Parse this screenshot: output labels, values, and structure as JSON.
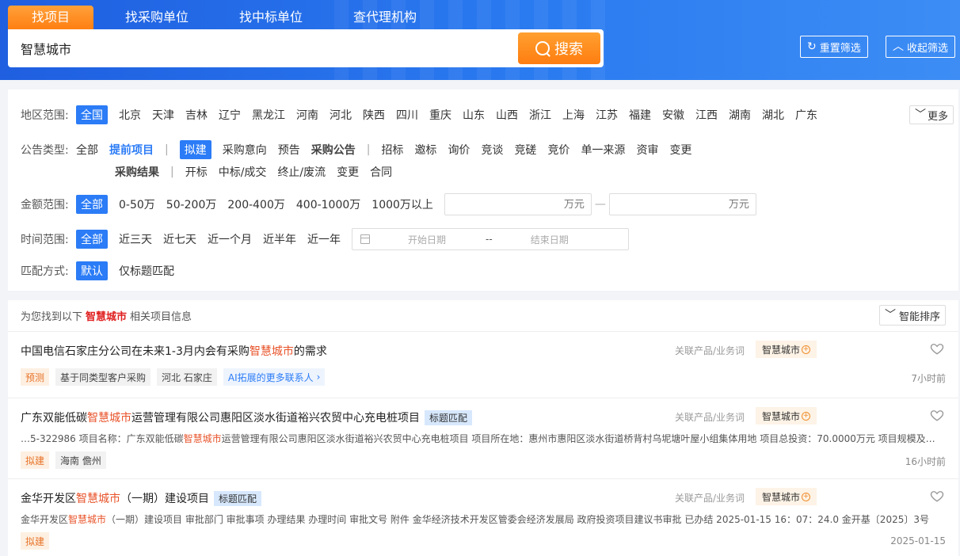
{
  "tabs": [
    "找项目",
    "找采购单位",
    "找中标单位",
    "查代理机构"
  ],
  "search": {
    "value": "智慧城市",
    "button": "搜索"
  },
  "header_buttons": {
    "reset": "重置筛选",
    "collapse": "收起筛选"
  },
  "filters": {
    "region": {
      "label": "地区范围:",
      "options": [
        "全国",
        "北京",
        "天津",
        "吉林",
        "辽宁",
        "黑龙江",
        "河南",
        "河北",
        "陕西",
        "四川",
        "重庆",
        "山东",
        "山西",
        "浙江",
        "上海",
        "江苏",
        "福建",
        "安徽",
        "江西",
        "湖南",
        "湖北",
        "广东"
      ],
      "more": "更多"
    },
    "type": {
      "label": "公告类型:",
      "row1": [
        "全部",
        "提前项目",
        "拟建",
        "采购意向",
        "预告",
        "采购公告",
        "招标",
        "邀标",
        "询价",
        "竞谈",
        "竞磋",
        "竞价",
        "单一来源",
        "资审",
        "变更"
      ],
      "row2": [
        "采购结果",
        "开标",
        "中标/成交",
        "终止/废流",
        "变更",
        "合同"
      ]
    },
    "amount": {
      "label": "金额范围:",
      "options": [
        "全部",
        "0-50万",
        "50-200万",
        "200-400万",
        "400-1000万",
        "1000万以上"
      ],
      "unit_placeholder": "万元",
      "sep": "—"
    },
    "time": {
      "label": "时间范围:",
      "options": [
        "全部",
        "近三天",
        "近七天",
        "近一个月",
        "近半年",
        "近一年"
      ],
      "start_placeholder": "开始日期",
      "end_placeholder": "结束日期",
      "sep": "--"
    },
    "match": {
      "label": "匹配方式:",
      "options": [
        "默认",
        "仅标题匹配"
      ]
    }
  },
  "results": {
    "header_prefix": "为您找到以下",
    "keyword": "智慧城市",
    "header_suffix": "相关项目信息",
    "sort": "智能排序",
    "rel_label": "关联产品/业务词",
    "rel_tag": "智慧城市",
    "items": [
      {
        "title_pre": "中国电信石家庄分公司在未来1-3月内会有采购",
        "title_hl": "智慧城市",
        "title_post": "的需求",
        "match": "",
        "desc_pre": "",
        "desc_hl": "",
        "desc_post": "",
        "badges": [
          "预测",
          "基于同类型客户采购",
          "河北 石家庄",
          "AI拓展的更多联系人"
        ],
        "time": "7小时前"
      },
      {
        "title_pre": "广东双能低碳",
        "title_hl": "智慧城市",
        "title_post": "运营管理有限公司惠阳区淡水街道裕兴农贸中心充电桩项目",
        "match": "标题匹配",
        "desc_pre": "…5-322986 项目名称：广东双能低碳",
        "desc_hl": "智慧城市",
        "desc_post": "运营管理有限公司惠阳区淡水街道裕兴农贸中心充电桩项目 项目所在地：惠州市惠阳区淡水街道桥背村乌坭塘叶屋小组集体用地 项目总投资：70.0000万元 项目规模及…",
        "badges": [
          "拟建",
          "海南 儋州"
        ],
        "time": "16小时前"
      },
      {
        "title_pre": "金华开发区",
        "title_hl": "智慧城市",
        "title_post": "（一期）建设项目",
        "match": "标题匹配",
        "desc_pre": "金华开发区",
        "desc_hl": "智慧城市",
        "desc_post": "（一期）建设项目 审批部门 审批事项 办理结果 办理时间 审批文号 附件 金华经济技术开发区管委会经济发展局 政府投资项目建议书审批 已办结 2025-01-15 16：07：24.0 金开基〔2025〕3号",
        "badges": [
          "拟建"
        ],
        "time": "2025-01-15"
      }
    ]
  }
}
